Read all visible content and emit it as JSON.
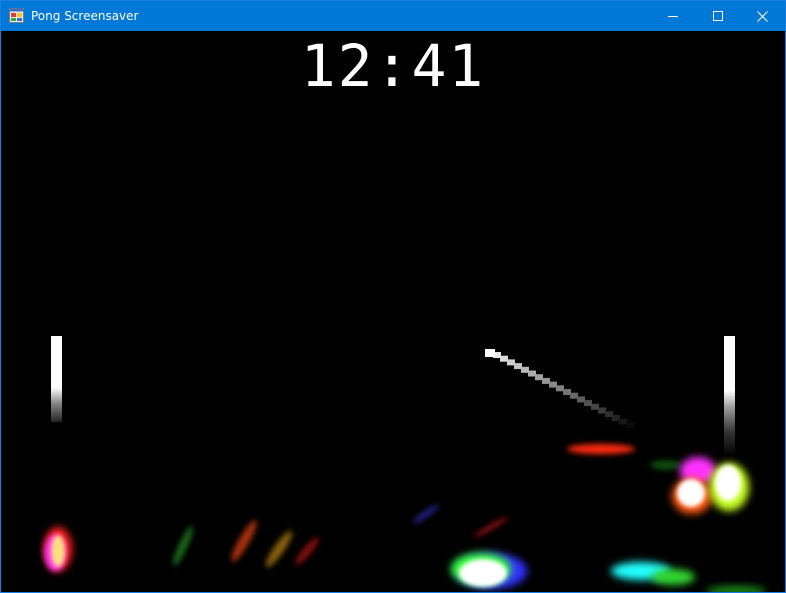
{
  "window": {
    "title": "Pong Screensaver",
    "app_icon": "windows-form-icon",
    "controls": {
      "minimize_icon": "minimize-icon",
      "maximize_icon": "maximize-icon",
      "close_icon": "close-icon"
    }
  },
  "game": {
    "clock": "12:41",
    "background": "#000000",
    "left_paddle": "white",
    "right_paddle": "white",
    "ball": "white"
  },
  "colors": {
    "titlebar": "#0078d7",
    "particle_red": "#ff2a10",
    "particle_magenta": "#ff30ff",
    "particle_green": "#30ff30",
    "particle_cyan": "#20ffff",
    "particle_blue": "#3030ff",
    "particle_yellow": "#ffff40"
  }
}
